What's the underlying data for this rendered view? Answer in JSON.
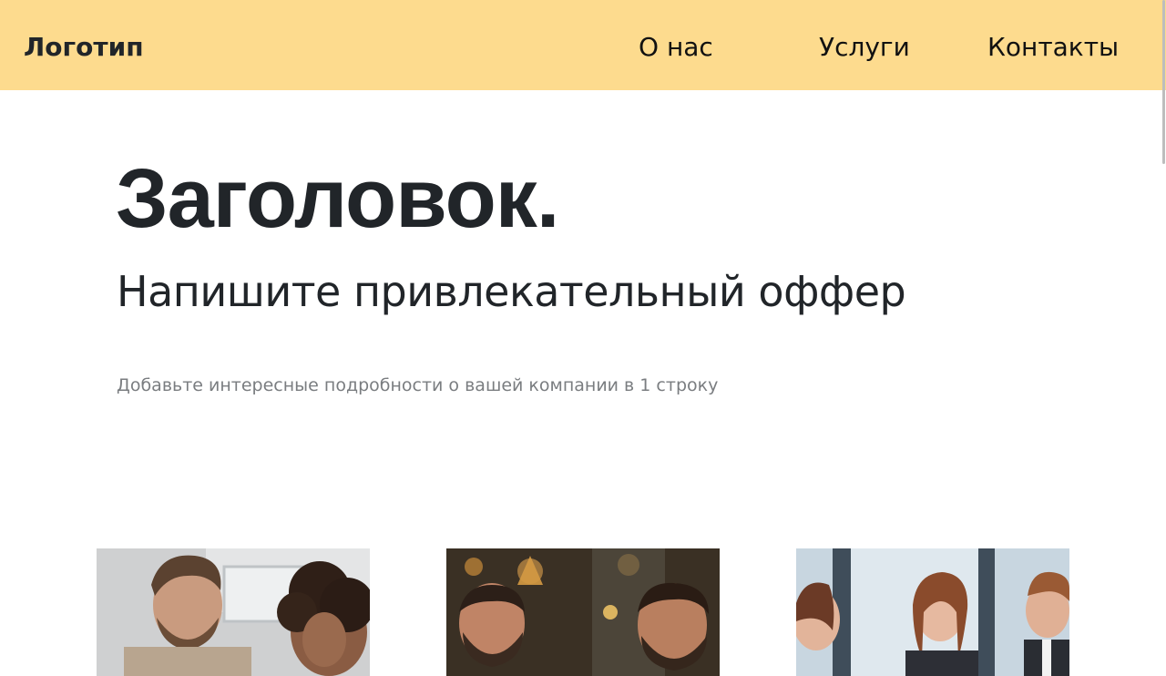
{
  "header": {
    "logo": "Логотип",
    "nav": [
      {
        "label": "О нас"
      },
      {
        "label": "Услуги"
      },
      {
        "label": "Контакты"
      }
    ]
  },
  "hero": {
    "title": "Заголовок.",
    "subtitle": "Напишите привлекательный оффер",
    "description": "Добавьте интересные подробности о вашей компании в 1 строку"
  },
  "gallery": {
    "images": [
      {
        "name": "business-meeting-photo-1"
      },
      {
        "name": "business-meeting-photo-2"
      },
      {
        "name": "business-meeting-photo-3"
      }
    ]
  },
  "colors": {
    "header_bg": "#fddb8e",
    "text_primary": "#212529",
    "text_muted": "#7a7d80"
  }
}
